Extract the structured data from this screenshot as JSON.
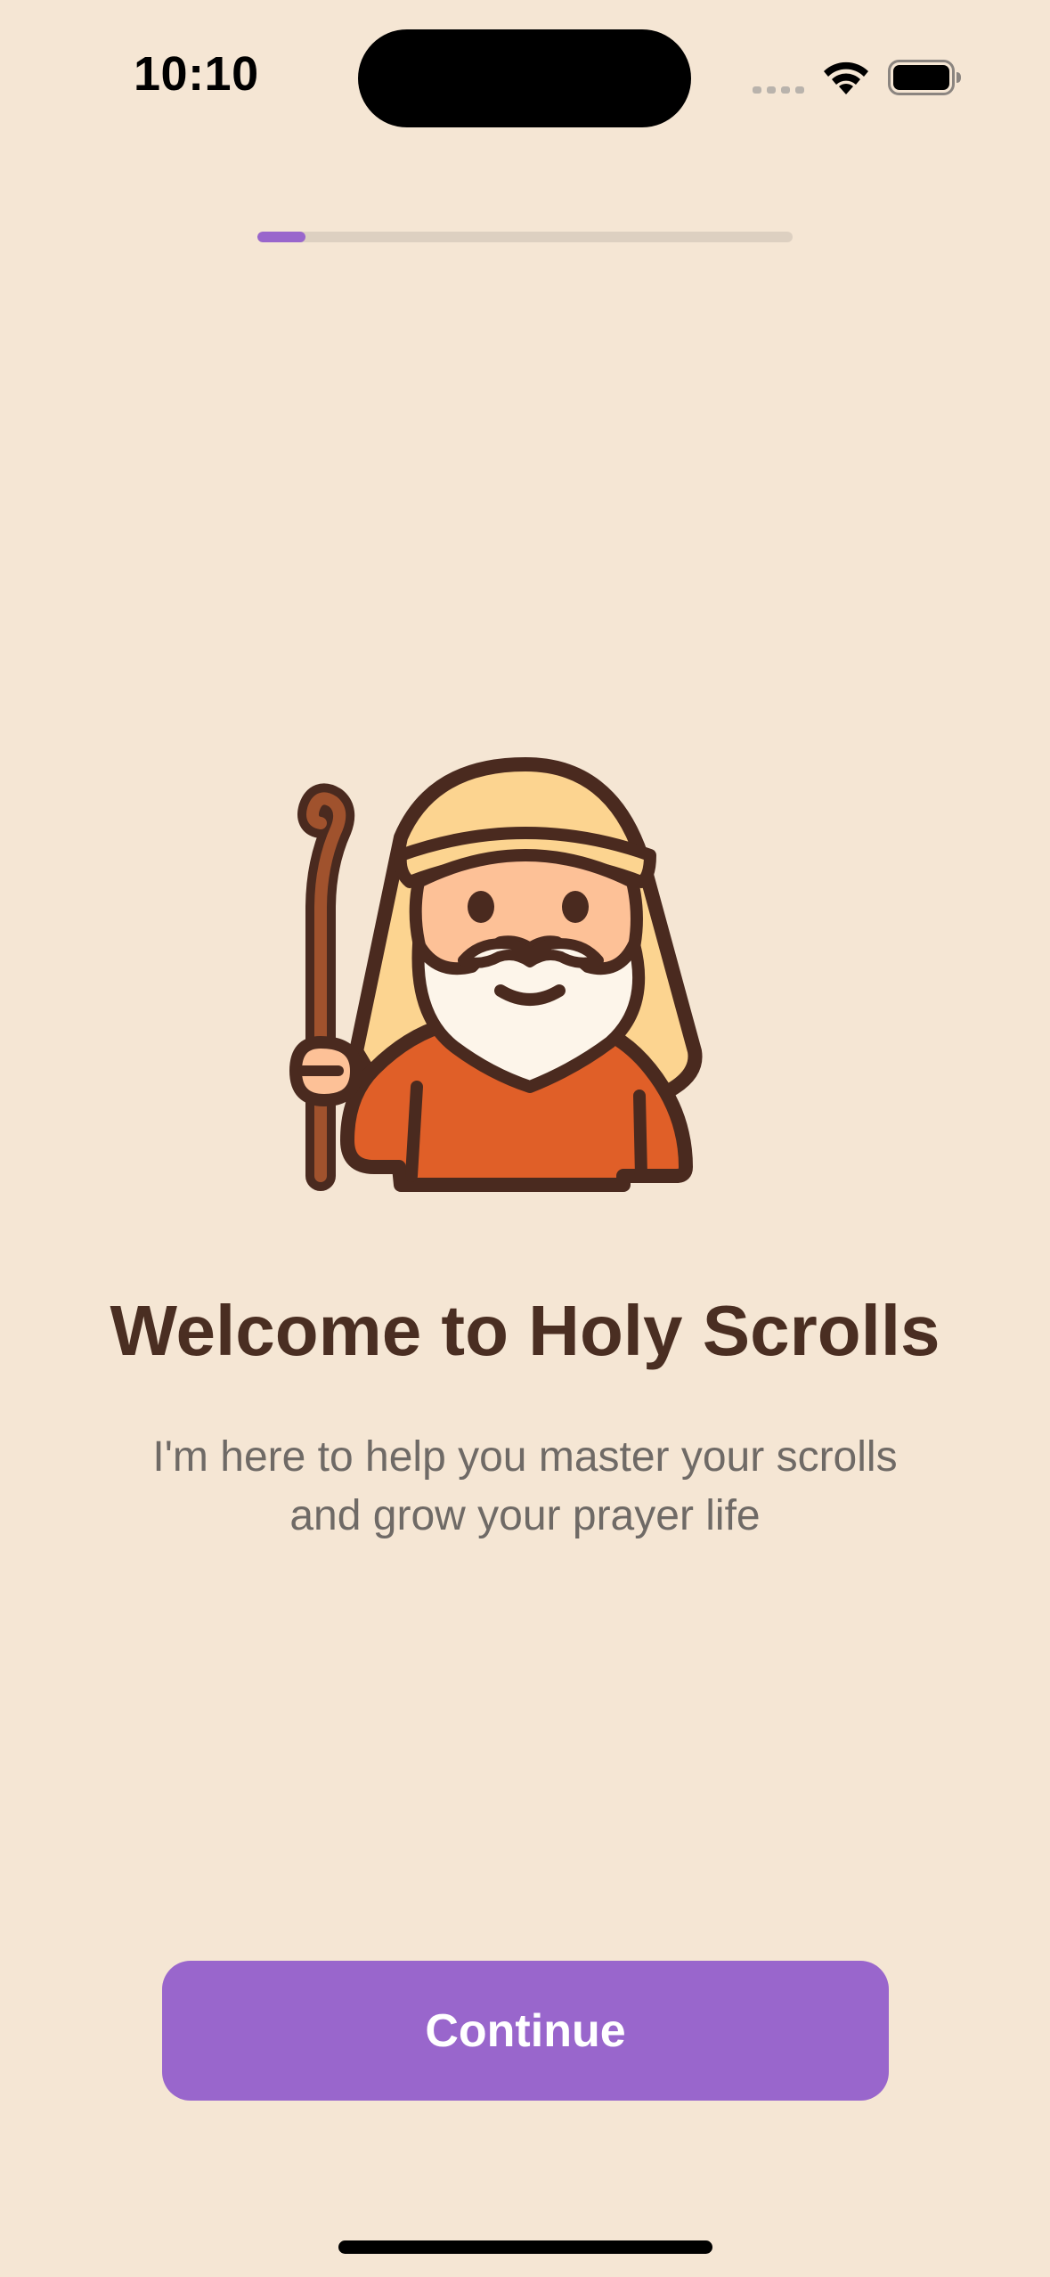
{
  "status_bar": {
    "time": "10:10"
  },
  "onboarding": {
    "progress_fraction": 0.09,
    "progress_color": "#9966cc"
  },
  "welcome": {
    "title": "Welcome to Holy Scrolls",
    "subtitle_line1": "I'm here to help you master your scrolls",
    "subtitle_line2": "and grow your prayer life",
    "mascot_icon": "shepherd-mascot-icon"
  },
  "actions": {
    "continue_label": "Continue",
    "button_color": "#9966cc"
  },
  "colors": {
    "background": "#f5e6d4",
    "title": "#4a2e22",
    "subtitle": "#6f6a66"
  }
}
